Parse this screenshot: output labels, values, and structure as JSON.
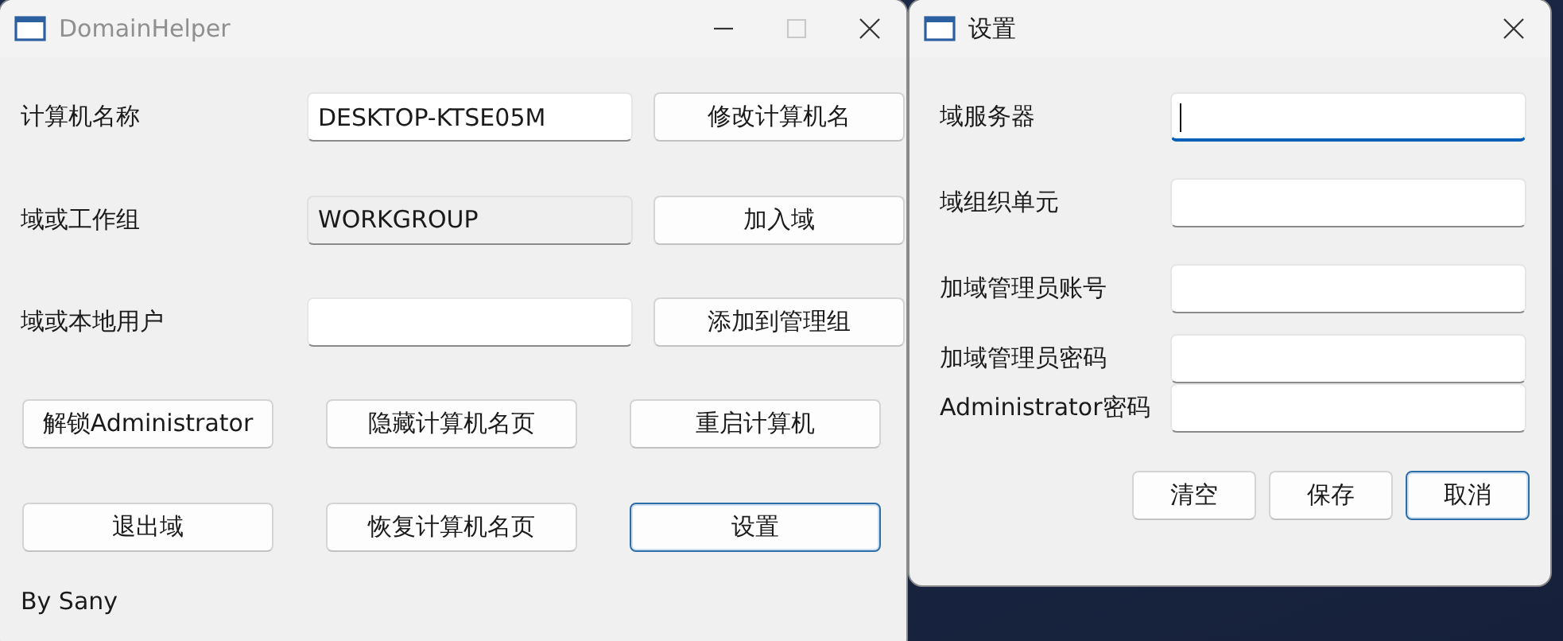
{
  "main_window": {
    "title": "DomainHelper",
    "active": false,
    "controls": [
      {
        "kind": "minimize",
        "disabled": false
      },
      {
        "kind": "maximize",
        "disabled": true
      },
      {
        "kind": "close",
        "disabled": false
      }
    ],
    "fields": [
      {
        "label": "计算机名称",
        "value": "DESKTOP-KTSE05M",
        "disabled": false,
        "button": {
          "label": "修改计算机名",
          "focused": false
        }
      },
      {
        "label": "域或工作组",
        "value": "WORKGROUP",
        "disabled": true,
        "button": {
          "label": "加入域",
          "focused": false
        }
      },
      {
        "label": "域或本地用户",
        "disabled": false,
        "button": {
          "label": "添加到管理组",
          "focused": false
        }
      }
    ],
    "buttons": [
      {
        "label": "解锁Administrator",
        "focused": false
      },
      {
        "label": "隐藏计算机名页",
        "focused": false
      },
      {
        "label": "重启计算机",
        "focused": false
      },
      {
        "label": "退出域",
        "focused": false
      },
      {
        "label": "恢复计算机名页",
        "focused": false
      },
      {
        "label": "设置",
        "focused": true
      }
    ],
    "footer": "By Sany"
  },
  "settings_window": {
    "title": "设置",
    "active": true,
    "controls": [
      {
        "kind": "close",
        "disabled": false
      }
    ],
    "fields": [
      {
        "label": "域服务器",
        "focused": true
      },
      {
        "label": "域组织单元",
        "focused": false
      },
      {
        "label": "加域管理员账号",
        "focused": false
      },
      {
        "label": "加域管理员密码",
        "focused": false
      },
      {
        "label": "Administrator密码",
        "focused": false
      }
    ],
    "buttons": [
      {
        "label": "清空",
        "focused": false
      },
      {
        "label": "保存",
        "focused": false
      },
      {
        "label": "取消",
        "focused": true
      }
    ]
  }
}
